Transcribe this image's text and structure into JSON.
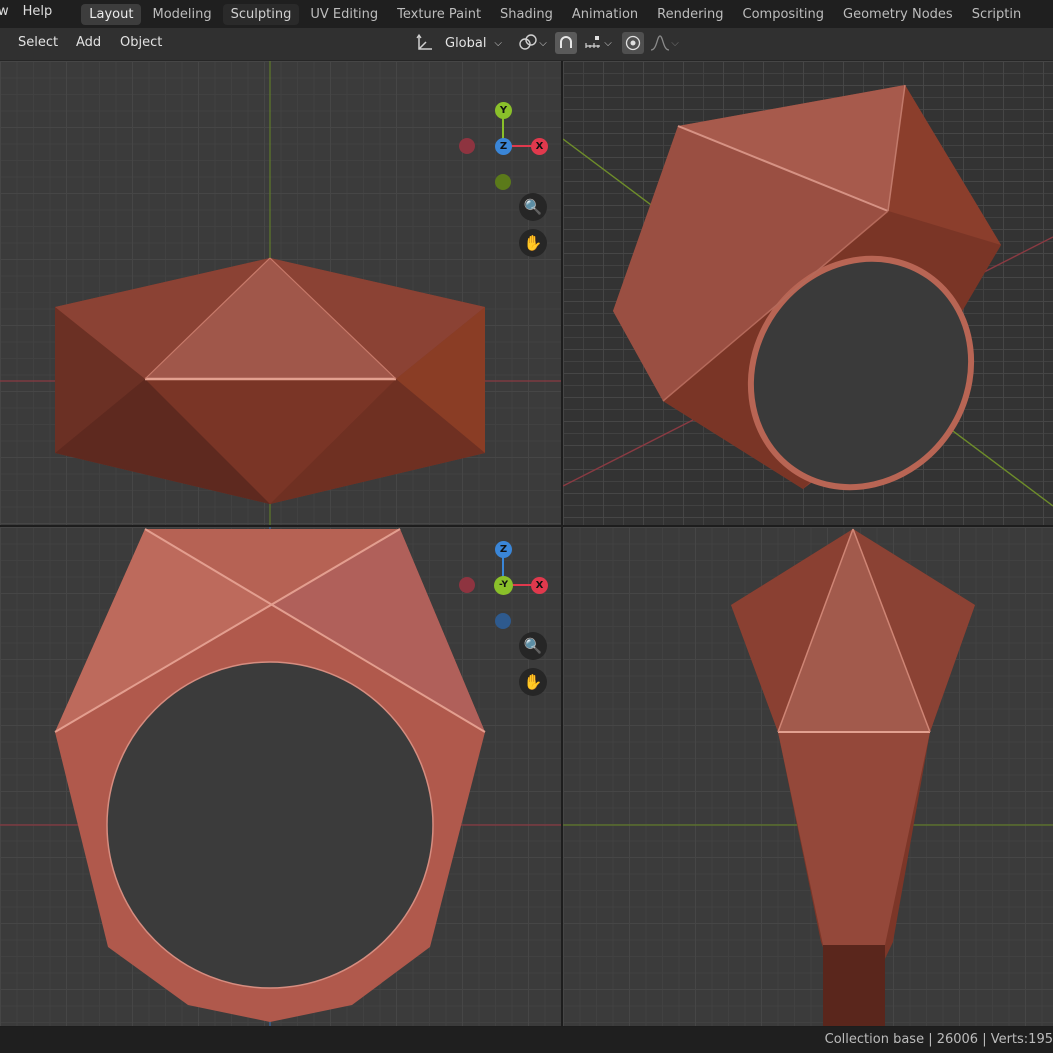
{
  "top_menu": {
    "file_fragment": "w",
    "help": "Help"
  },
  "workspace_tabs": [
    {
      "label": "Layout"
    },
    {
      "label": "Modeling"
    },
    {
      "label": "Sculpting"
    },
    {
      "label": "UV Editing"
    },
    {
      "label": "Texture Paint"
    },
    {
      "label": "Shading"
    },
    {
      "label": "Animation"
    },
    {
      "label": "Rendering"
    },
    {
      "label": "Compositing"
    },
    {
      "label": "Geometry Nodes"
    },
    {
      "label": "Scriptin"
    }
  ],
  "header": {
    "select": "Select",
    "add": "Add",
    "object": "Object",
    "orientation": "Global"
  },
  "gizmo_top": {
    "y": "Y",
    "z": "Z",
    "x": "X"
  },
  "gizmo_front": {
    "z": "Z",
    "y": "-Y",
    "x": "X"
  },
  "status": {
    "text": "Collection base | 26006 | Verts:195"
  },
  "colors": {
    "accent_tab": "#3d3d3d",
    "axis_x": "#e0394d",
    "axis_y": "#8ac02a",
    "axis_z": "#3a86d8",
    "mesh": "#b35346"
  }
}
